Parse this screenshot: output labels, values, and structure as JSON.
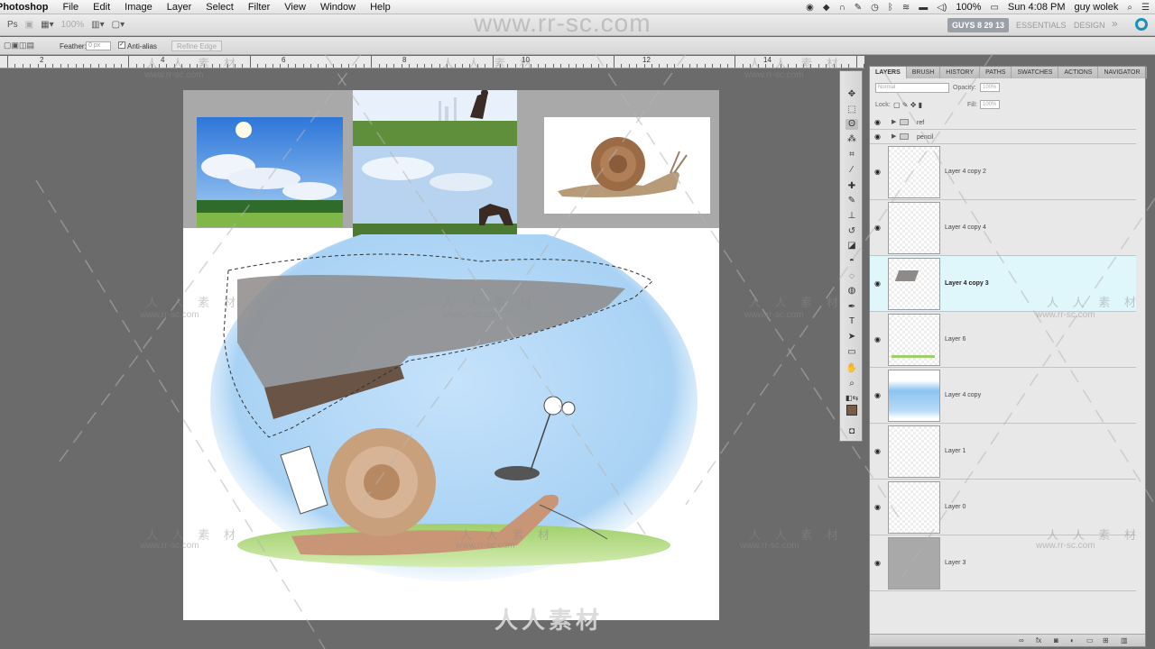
{
  "menubar": {
    "app_name": "Photoshop",
    "menus": [
      "File",
      "Edit",
      "Image",
      "Layer",
      "Select",
      "Filter",
      "View",
      "Window",
      "Help"
    ],
    "battery": "100%",
    "clock": "Sun 4:08 PM",
    "user": "guy wolek"
  },
  "appbar": {
    "zoom": "100%",
    "workspace_name": "GUYS 8 29 13",
    "workspaces": [
      "ESSENTIALS",
      "DESIGN"
    ],
    "more": "»"
  },
  "options": {
    "feather_label": "Feather:",
    "feather_value": "0 px",
    "antialias_label": "Anti-alias",
    "refine_edge_label": "Refine Edge"
  },
  "ruler": {
    "labels": [
      "2",
      "4",
      "6",
      "8",
      "10",
      "12",
      "14"
    ]
  },
  "panel": {
    "tabs": [
      "LAYERS",
      "BRUSH",
      "HISTORY",
      "PATHS",
      "SWATCHES",
      "ACTIONS",
      "NAVIGATOR"
    ],
    "blend_mode": "Normal",
    "opacity_label": "Opacity:",
    "opacity_value": "100%",
    "lock_label": "Lock:",
    "fill_label": "Fill:",
    "fill_value": "100%"
  },
  "layers": [
    {
      "name": "ref",
      "kind": "group"
    },
    {
      "name": "pencil",
      "kind": "group"
    },
    {
      "name": "Layer 4 copy 2",
      "kind": "layer"
    },
    {
      "name": "Layer 4 copy 4",
      "kind": "layer"
    },
    {
      "name": "Layer 4 copy 3",
      "kind": "layer",
      "selected": true
    },
    {
      "name": "Layer 6",
      "kind": "layer"
    },
    {
      "name": "Layer 4 copy",
      "kind": "layer"
    },
    {
      "name": "Layer 1",
      "kind": "layer"
    },
    {
      "name": "Layer 0",
      "kind": "layer"
    },
    {
      "name": "Layer 3",
      "kind": "layer"
    }
  ],
  "watermark": {
    "url": "www.rr-sc.com",
    "brand_cn": "人人素材",
    "brand_spaced": "人 人 素 材"
  },
  "colors": {
    "selection_highlight": "#dff6fb",
    "canvas_bg": "#6b6b6b",
    "foreground_swatch": "#7a5b44"
  }
}
